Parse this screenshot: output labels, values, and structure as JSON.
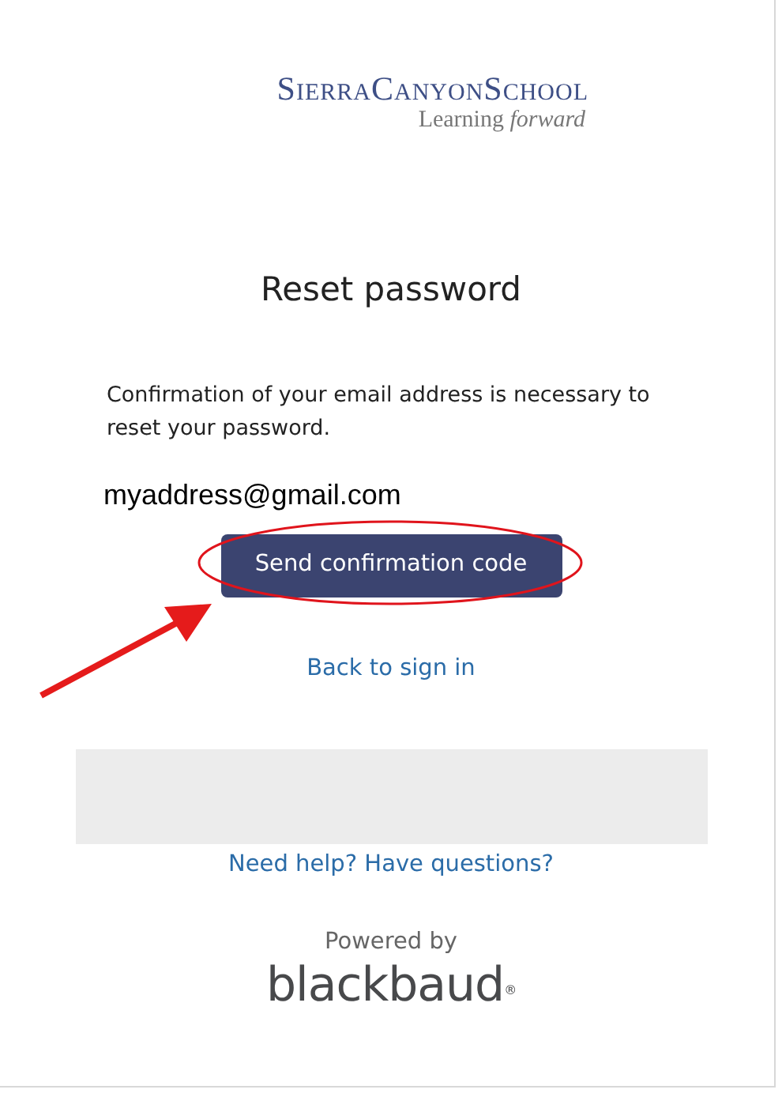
{
  "logo": {
    "name": "SierraCanyonSchool",
    "tagline": "Learning *forward*"
  },
  "title": "Reset password",
  "message": "Confirmation of your email address is necessary to reset your password.",
  "email": "myaddress@gmail.com",
  "send_button": "Send confirmation code",
  "back_link": "Back to sign in",
  "help_link": "Need help? Have questions?",
  "powered_by": "Powered by",
  "brand": "blackbaud$^{®}$"
}
